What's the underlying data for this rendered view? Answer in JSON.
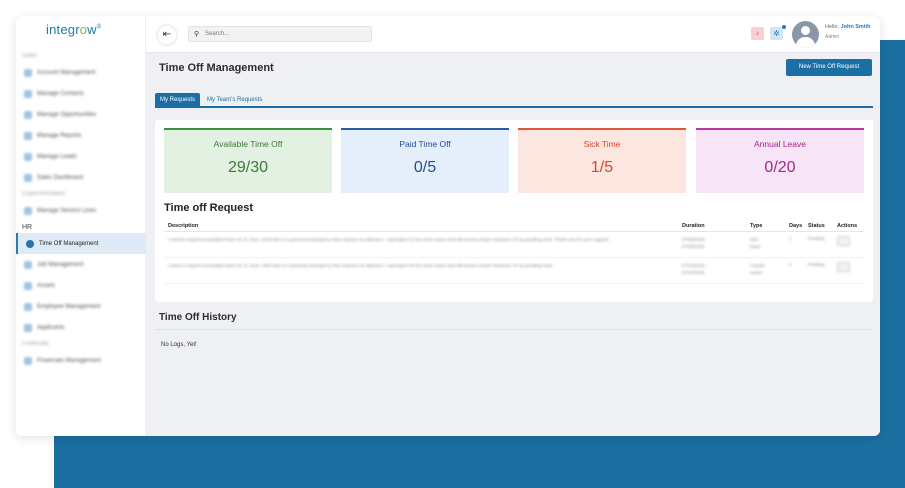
{
  "brand": {
    "logo_text_a": "integr",
    "logo_text_o": "o",
    "logo_text_b": "w",
    "logo_mark": "®"
  },
  "sidebar": {
    "sections": [
      {
        "label": "Sales",
        "items": [
          "Account Management",
          "Manage Contacts",
          "Manage Opportunities",
          "Manage Reports",
          "Manage Leads",
          "Sales Dashboard"
        ]
      },
      {
        "label": "Experimentation",
        "items": [
          "Manage Service Lines"
        ]
      },
      {
        "label": "HR",
        "items": [
          "Time Off Management",
          "Job Management",
          "Assets",
          "Employee Management",
          "Applicants"
        ]
      },
      {
        "label": "Financials",
        "items": [
          "Financials Management"
        ]
      }
    ]
  },
  "topbar": {
    "search_placeholder": "Search...",
    "hello_prefix": "Hello,",
    "user_name": "John Smith",
    "user_role": "Admin"
  },
  "page": {
    "title": "Time Off Management",
    "new_request_label": "New Time Off Request",
    "tabs": [
      "My Requests",
      "My Team's Requests"
    ]
  },
  "stats": [
    {
      "label": "Available Time Off",
      "value": "29/30",
      "color": "#3a7a34"
    },
    {
      "label": "Paid Time Off",
      "value": "0/5",
      "color": "#244d94"
    },
    {
      "label": "Sick Time",
      "value": "1/5",
      "color": "#d9452a"
    },
    {
      "label": "Annual Leave",
      "value": "0/20",
      "color": "#a52788"
    }
  ],
  "request_table": {
    "title": "Time off Request",
    "headers": [
      "Description",
      "Duration",
      "Type",
      "Days",
      "Status",
      "Actions"
    ],
    "rows": [
      {
        "description": "I need to request immediate leave for 11 June, 2025 due to a personal emergency that requires my attention. I apologize for the short notice and will ensure proper handover of my pending work. Thank you for your support.",
        "duration": "07/06/2025 - 07/06/2025",
        "type": "Sick leave",
        "days": "1",
        "status": "Pending"
      },
      {
        "description": "I need to request immediate leave for 11 June, 2025 due to a personal emergency that requires my attention. I apologize for the short notice and will ensure proper handover of my pending work.",
        "duration": "07/10/2025 - 07/13/2025",
        "type": "Casual Leave",
        "days": "4",
        "status": "Pending"
      }
    ]
  },
  "history": {
    "title": "Time Off History",
    "empty_text": "No Logs, Yet!"
  }
}
